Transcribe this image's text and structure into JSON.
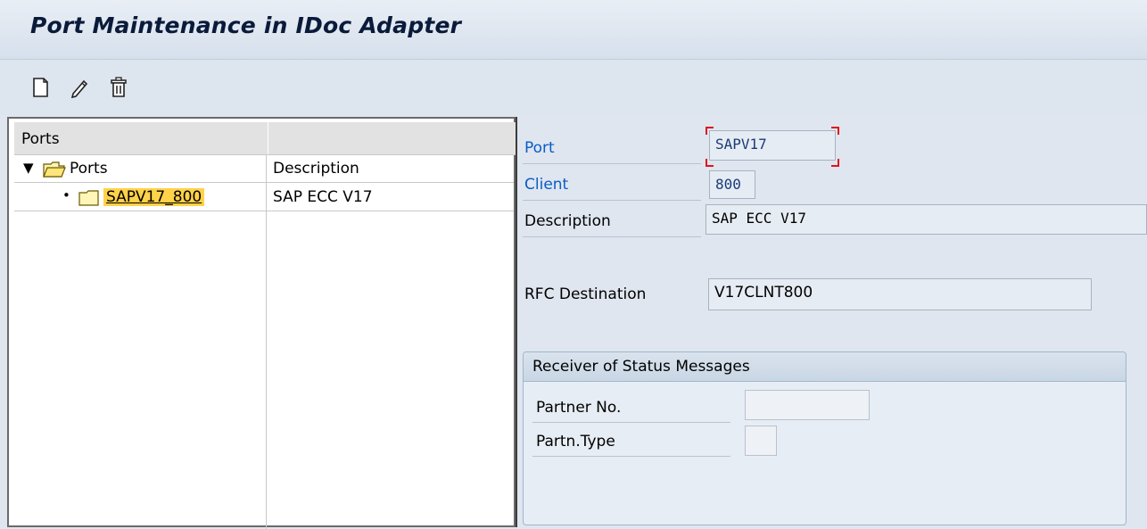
{
  "window": {
    "title": "Port Maintenance in IDoc Adapter"
  },
  "toolbar": {
    "buttons": [
      {
        "icon": "create-document-icon",
        "tooltip": "Create"
      },
      {
        "icon": "pencil-icon",
        "tooltip": "Change"
      },
      {
        "icon": "trash-icon",
        "tooltip": "Delete"
      }
    ]
  },
  "tree": {
    "header": {
      "col1": "Ports",
      "col2": ""
    },
    "root": {
      "label": "Ports",
      "description": "Description",
      "expanded": true
    },
    "children": [
      {
        "label": "SAPV17_800",
        "description": "SAP ECC V17",
        "selected": true
      }
    ]
  },
  "detail": {
    "port": {
      "label": "Port",
      "value": "SAPV17"
    },
    "client": {
      "label": "Client",
      "value": "800"
    },
    "description": {
      "label": "Description",
      "value": "SAP ECC V17"
    },
    "rfc_destination": {
      "label": "RFC Destination",
      "value": "V17CLNT800"
    },
    "status_group": {
      "title": "Receiver of Status Messages",
      "partner_no": {
        "label": "Partner No.",
        "value": ""
      },
      "partner_type": {
        "label": "Partn.Type",
        "value": ""
      }
    }
  },
  "colors": {
    "accent_blue": "#0a5cc7",
    "selection": "#ffd24a",
    "focus_bracket": "#e0141e"
  }
}
